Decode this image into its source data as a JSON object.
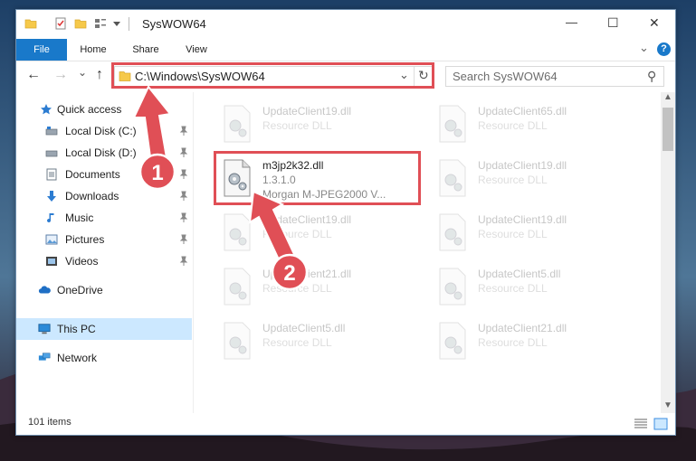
{
  "window": {
    "title": "SysWOW64",
    "minimize_glyph": "—",
    "maximize_glyph": "☐",
    "close_glyph": "✕"
  },
  "ribbon": {
    "tabs": [
      "File",
      "Home",
      "Share",
      "View"
    ],
    "expand_glyph": "⌄",
    "help_glyph": "?"
  },
  "nav": {
    "address": "C:\\Windows\\SysWOW64",
    "search_placeholder": "Search SysWOW64",
    "back_glyph": "←",
    "forward_glyph": "→",
    "recent_glyph": "⌄",
    "up_glyph": "↑",
    "refresh_glyph": "↻",
    "dropdown_glyph": "⌄",
    "search_glyph": "⚲"
  },
  "sidebar": {
    "quick_access": "Quick access",
    "items": [
      {
        "label": "Local Disk (C:)",
        "icon": "drive-icon"
      },
      {
        "label": "Local Disk (D:)",
        "icon": "drive-icon"
      },
      {
        "label": "Documents",
        "icon": "documents-icon"
      },
      {
        "label": "Downloads",
        "icon": "downloads-icon"
      },
      {
        "label": "Music",
        "icon": "music-icon"
      },
      {
        "label": "Pictures",
        "icon": "pictures-icon"
      },
      {
        "label": "Videos",
        "icon": "videos-icon"
      }
    ],
    "onedrive": "OneDrive",
    "this_pc": "This PC",
    "network": "Network"
  },
  "files": {
    "highlighted": {
      "name": "m3jp2k32.dll",
      "version": "1.3.1.0",
      "description": "Morgan M-JPEG2000 V..."
    },
    "left_column": [
      {
        "name": "UpdateClient19.dll",
        "type": "Resource DLL"
      },
      {
        "name": "UpdateClient19.dll",
        "type": "Resource DLL"
      },
      {
        "name": "UpdateClient21.dll",
        "type": "Resource DLL"
      },
      {
        "name": "UpdateClient5.dll",
        "type": "Resource DLL"
      }
    ],
    "right_column": [
      {
        "name": "UpdateClient65.dll",
        "type": "Resource DLL"
      },
      {
        "name": "UpdateClient19.dll",
        "type": "Resource DLL"
      },
      {
        "name": "UpdateClient19.dll",
        "type": "Resource DLL"
      },
      {
        "name": "UpdateClient5.dll",
        "type": "Resource DLL"
      },
      {
        "name": "UpdateClient21.dll",
        "type": "Resource DLL"
      }
    ]
  },
  "status": {
    "item_count": "101 items"
  },
  "annotations": {
    "step1": "1",
    "step2": "2",
    "color": "#e04f56"
  }
}
